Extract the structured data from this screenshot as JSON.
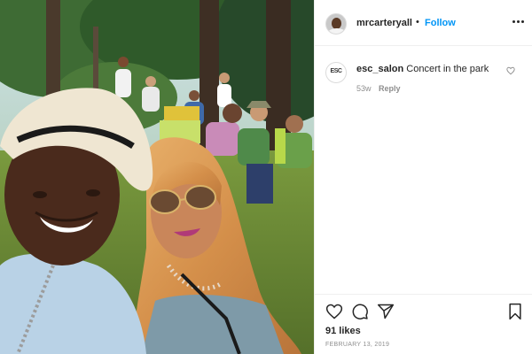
{
  "post": {
    "image_alt": "Selfie of a smiling man in a white hat and a woman in sunglasses at a park concert with trees and seated people behind"
  },
  "header": {
    "username": "mrcarteryall",
    "separator": "•",
    "follow_label": "Follow",
    "avatar_icon": "user-avatar",
    "more_icon": "more-options-icon"
  },
  "comments": [
    {
      "username": "esc_salon",
      "text": "Concert in the park",
      "age": "53w",
      "reply_label": "Reply",
      "avatar_icon": "esc-salon-logo",
      "avatar_text": "ESC"
    }
  ],
  "actions": {
    "like_icon": "heart-icon",
    "comment_icon": "comment-icon",
    "share_icon": "share-icon",
    "save_icon": "bookmark-icon"
  },
  "stats": {
    "likes": "91 likes",
    "date": "FEBRUARY 13, 2019"
  },
  "colors": {
    "follow_blue": "#0095f6",
    "text_primary": "#262626",
    "text_secondary": "#8e8e8e",
    "border": "#efefef"
  }
}
